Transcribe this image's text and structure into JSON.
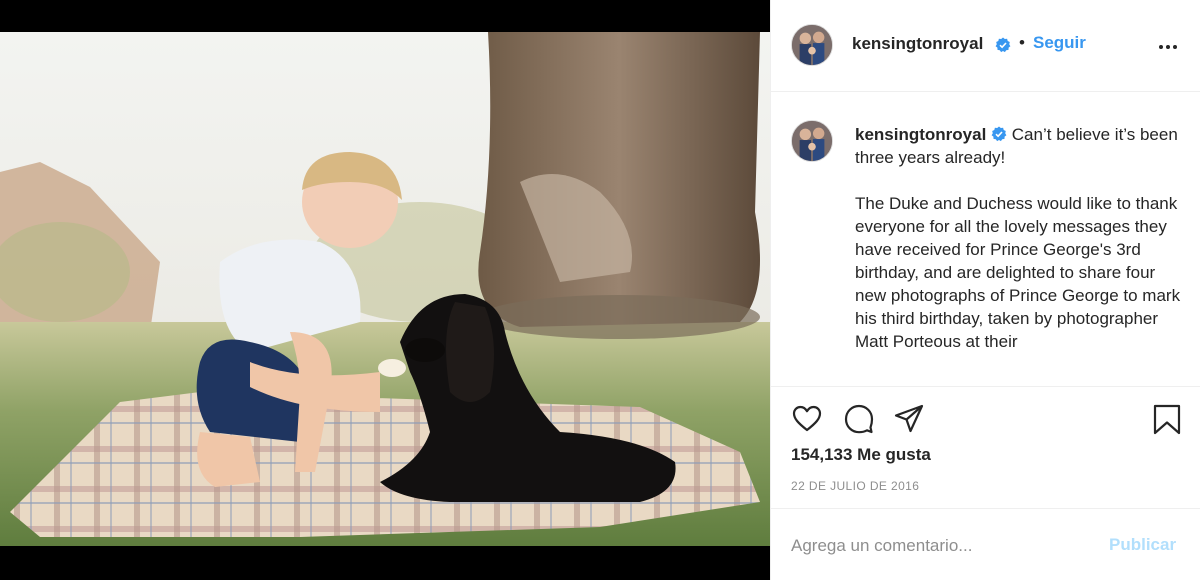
{
  "post": {
    "username": "kensingtonroyal",
    "separator": "•",
    "follow_label": "Seguir",
    "caption_line1": "Can’t believe it’s been three years already!",
    "caption_line2": "The Duke and Duchess would like to thank everyone for all the lovely messages they have received for Prince George's 3rd birthday, and are delighted to share four new photographs of Prince George to mark his third birthday, taken by photographer Matt Porteous at their",
    "likes": "154,133 Me gusta",
    "date": "22 DE JULIO DE 2016",
    "comment_placeholder": "Agrega un comentario...",
    "publish_label": "Publicar"
  },
  "icons": {
    "verified": "verified-badge-icon",
    "more": "more-options-icon",
    "like": "heart-icon",
    "comment": "comment-bubble-icon",
    "share": "paper-plane-icon",
    "save": "bookmark-icon"
  },
  "colors": {
    "link_blue": "#3897f0",
    "publish_disabled": "#b2dffc",
    "verified": "#3897f0",
    "muted": "#8e8e8e"
  }
}
